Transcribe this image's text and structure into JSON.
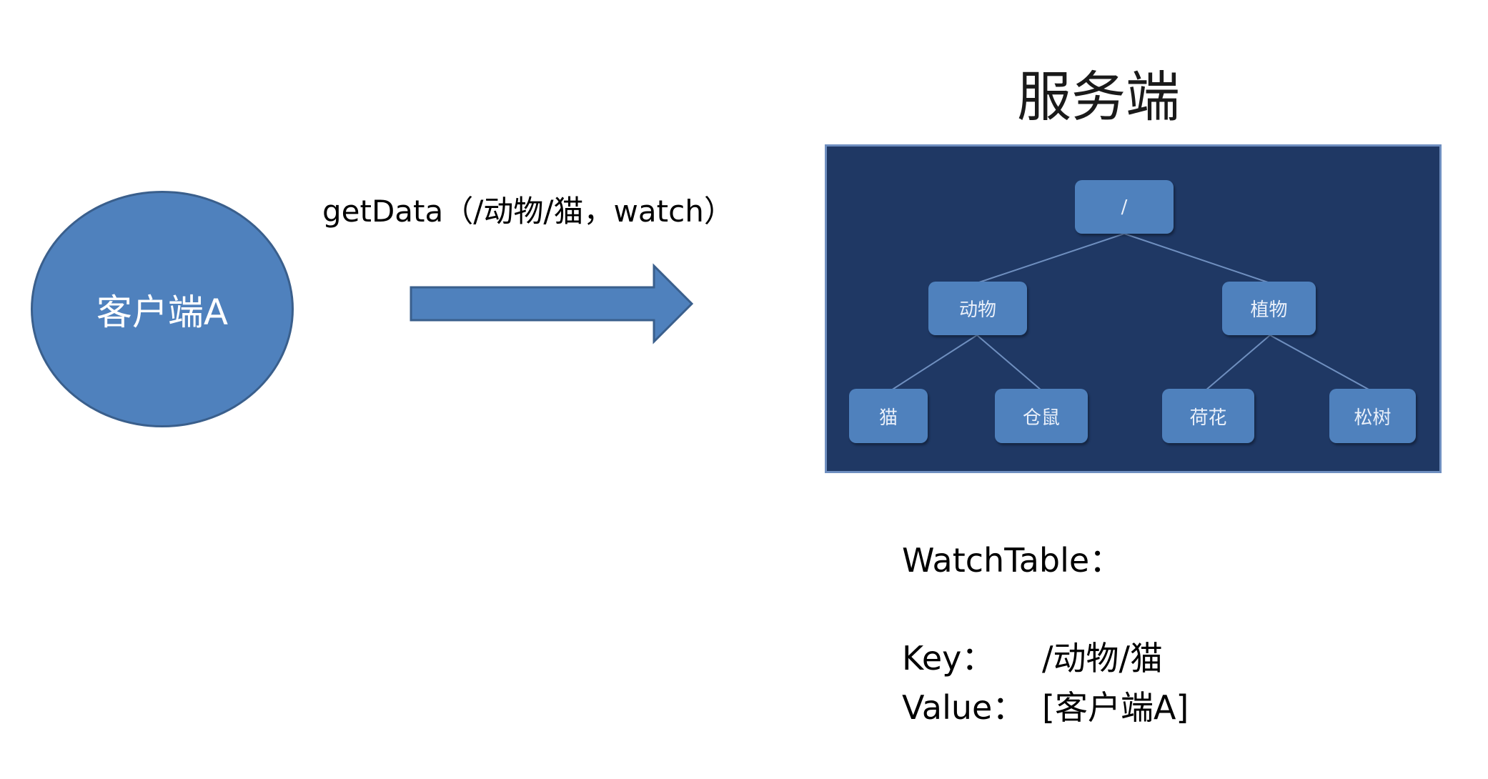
{
  "client": {
    "label": "客户端A"
  },
  "request": {
    "label": "getData（/动物/猫，watch）"
  },
  "server": {
    "title": "服务端",
    "tree": {
      "root": "/",
      "level1": [
        "动物",
        "植物"
      ],
      "level2": [
        "猫",
        "仓鼠",
        "荷花",
        "松树"
      ]
    }
  },
  "watch_table": {
    "title": "WatchTable：",
    "key_label": "Key：",
    "key_value": "/动物/猫",
    "value_label": "Value：",
    "value_value": "[客户端A]"
  },
  "colors": {
    "node_fill": "#4f81bd",
    "panel_fill": "#1f3864",
    "arrow_fill": "#4f81bd"
  }
}
